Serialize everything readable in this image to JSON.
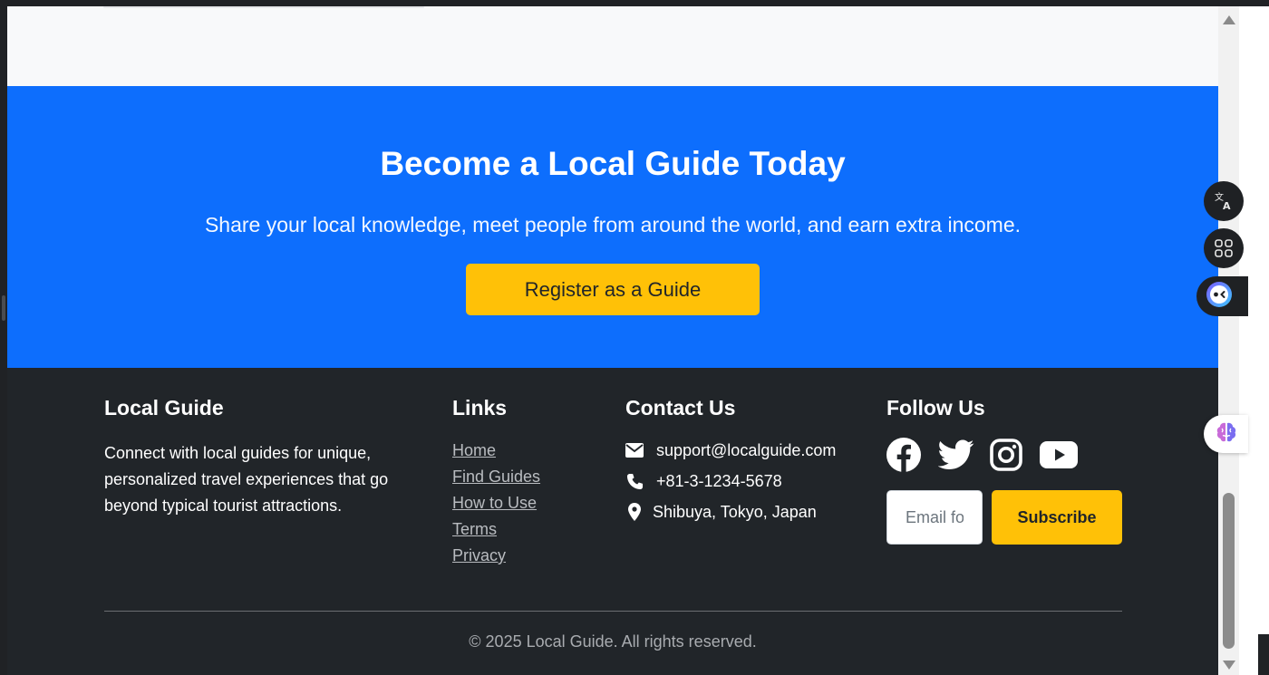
{
  "cta": {
    "title": "Become a Local Guide Today",
    "subtitle": "Share your local knowledge, meet people from around the world, and earn extra income.",
    "button_label": "Register as a Guide"
  },
  "footer": {
    "about": {
      "heading": "Local Guide",
      "text": "Connect with local guides for unique, personalized travel experiences that go beyond typical tourist attractions."
    },
    "links": {
      "heading": "Links",
      "items": [
        {
          "label": "Home"
        },
        {
          "label": "Find Guides"
        },
        {
          "label": "How to Use"
        },
        {
          "label": "Terms"
        },
        {
          "label": "Privacy"
        }
      ]
    },
    "contact": {
      "heading": "Contact Us",
      "email": "support@localguide.com",
      "phone": "+81-3-1234-5678",
      "location": "Shibuya, Tokyo, Japan"
    },
    "follow": {
      "heading": "Follow Us",
      "social_icons": [
        "facebook-icon",
        "twitter-icon",
        "instagram-icon",
        "youtube-icon"
      ],
      "email_placeholder": "Email for newsletter",
      "subscribe_label": "Subscribe"
    },
    "copyright": "© 2025 Local Guide. All rights reserved."
  },
  "floating_tools": {
    "icons": [
      "translate-icon",
      "apps-icon",
      "assistant-icon",
      "brain-icon"
    ]
  },
  "colors": {
    "primary": "#0d6efd",
    "accent": "#ffc107",
    "footer_bg": "#212529",
    "page_bg": "#f8f9fa"
  }
}
